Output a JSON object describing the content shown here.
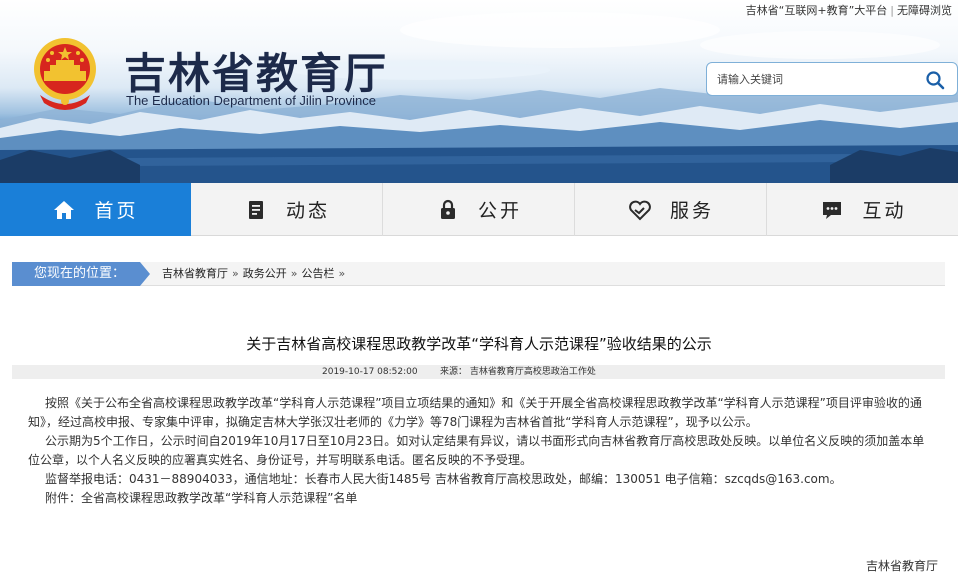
{
  "header": {
    "top_links": {
      "platform": "吉林省“互联网+教育”大平台",
      "separator": "|",
      "accessible": "无障碍浏览"
    },
    "title": "吉林省教育厅",
    "subtitle": "The Education Department of Jilin Province",
    "search": {
      "placeholder": "请输入关键词",
      "icon": "search-icon"
    }
  },
  "nav": {
    "items": [
      {
        "label": "首页",
        "icon": "home-icon",
        "active": true
      },
      {
        "label": "动态",
        "icon": "document-icon",
        "active": false
      },
      {
        "label": "公开",
        "icon": "lock-icon",
        "active": false
      },
      {
        "label": "服务",
        "icon": "handshake-heart-icon",
        "active": false
      },
      {
        "label": "互动",
        "icon": "chat-bubble-icon",
        "active": false
      }
    ]
  },
  "breadcrumb": {
    "label": "您现在的位置：",
    "items": [
      "吉林省教育厅",
      "政务公开",
      "公告栏"
    ],
    "separator": "»"
  },
  "article": {
    "title": "关于吉林省高校课程思政教学改革“学科育人示范课程”验收结果的公示",
    "date": "2019-10-17 08:52:00",
    "source": "来源：  吉林省教育厅高校思政治工作处",
    "paragraphs": [
      "按照《关于公布全省高校课程思政教学改革“学科育人示范课程”项目立项结果的通知》和《关于开展全省高校课程思政教学改革“学科育人示范课程”项目评审验收的通知》，经过高校申报、专家集中评审，拟确定吉林大学张汉壮老师的《力学》等78门课程为吉林省首批“学科育人示范课程”，现予以公示。",
      "公示期为5个工作日，公示时间自2019年10月17日至10月23日。如对认定结果有异议，请以书面形式向吉林省教育厅高校思政处反映。以单位名义反映的须加盖本单位公章，以个人名义反映的应署真实姓名、身份证号，并写明联系电话。匿名反映的不予受理。",
      "监督举报电话：0431－88904033，通信地址：长春市人民大街1485号 吉林省教育厅高校思政处，邮编：130051 电子信箱：szcqds@163.com。"
    ],
    "attachment": "附件：全省高校课程思政教学改革“学科育人示范课程”名单",
    "signature": "吉林省教育厅"
  },
  "colors": {
    "nav_active": "#1a7fd8",
    "crumb_label_bg": "#5a8ed0",
    "title_text": "#1d2a4a",
    "emblem_red": "#d7261e",
    "emblem_gold": "#f2c230"
  }
}
